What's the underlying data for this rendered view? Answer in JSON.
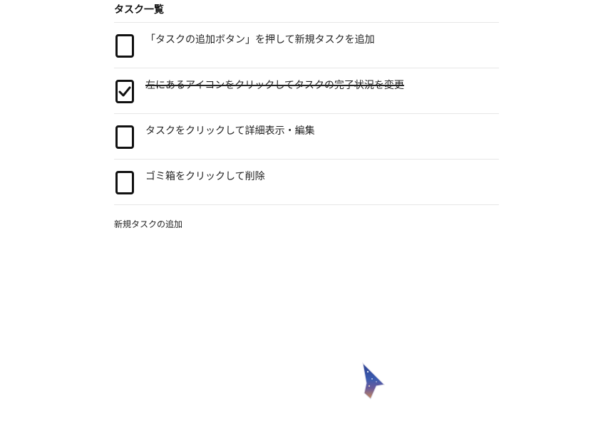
{
  "task_list": {
    "title": "タスク一覧",
    "tasks": [
      {
        "label": "「タスクの追加ボタン」を押して新規タスクを追加",
        "done": false
      },
      {
        "label": "左にあるアイコンをクリックしてタスクの完了状況を変更",
        "done": true
      },
      {
        "label": "タスクをクリックして詳細表示・編集",
        "done": false
      },
      {
        "label": "ゴミ箱をクリックして削除",
        "done": false
      }
    ],
    "add_task_label": "新規タスクの追加"
  },
  "icons": {
    "unchecked": "checkbox-empty-icon",
    "checked": "checkbox-checked-icon",
    "cursor": "pointer-cursor-icon"
  }
}
